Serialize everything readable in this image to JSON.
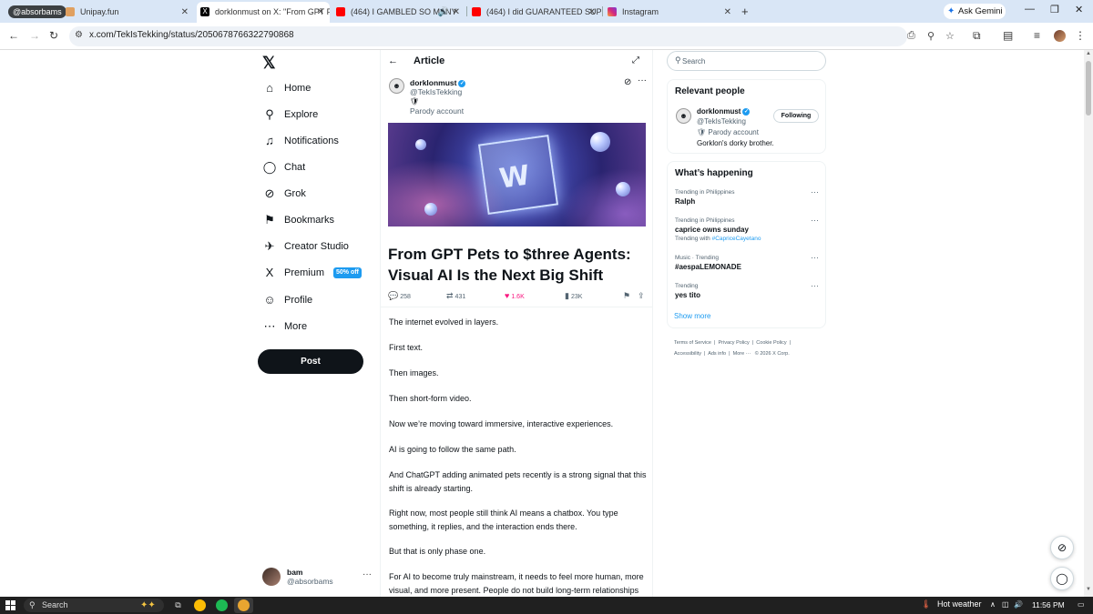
{
  "browser": {
    "profile_chip": "@absorbams",
    "tabs": [
      {
        "title": "Unipay.fun",
        "icon": "unipay-favicon"
      },
      {
        "title": "dorklonmust on X: \"From GPT P",
        "icon": "x-favicon"
      },
      {
        "title": "(464) I GAMBLED SO MANY",
        "icon": "youtube-favicon"
      },
      {
        "title": "(464) I did GUARANTEED SUPER",
        "icon": "youtube-favicon"
      },
      {
        "title": "Instagram",
        "icon": "instagram-favicon"
      }
    ],
    "gemini_label": "Ask Gemini",
    "url": "x.com/TekIsTekking/status/2050678766322790868"
  },
  "sidenav": {
    "items": [
      {
        "label": "Home",
        "icon": "⌂"
      },
      {
        "label": "Explore",
        "icon": "⚲"
      },
      {
        "label": "Notifications",
        "icon": "♫"
      },
      {
        "label": "Chat",
        "icon": "◯"
      },
      {
        "label": "Grok",
        "icon": "⊘"
      },
      {
        "label": "Bookmarks",
        "icon": "⚑"
      },
      {
        "label": "Creator Studio",
        "icon": "✈"
      },
      {
        "label": "Premium",
        "icon": "X"
      },
      {
        "label": "Profile",
        "icon": "☺"
      },
      {
        "label": "More",
        "icon": "⋯"
      }
    ],
    "premium_badge": "50% off",
    "post_label": "Post",
    "me": {
      "name": "bam",
      "handle": "@absorbams"
    }
  },
  "article": {
    "header_title": "Article",
    "author": {
      "name": "dorklonmust",
      "handle": "@TekIsTekking",
      "emoji": "🛡",
      "parody": "Parody account"
    },
    "headline": "From GPT Pets to $three Agents: Visual AI Is the Next Big Shift",
    "hero_text": "W",
    "stats": {
      "replies": "258",
      "reposts": "431",
      "likes": "1.6K",
      "views": "23K"
    },
    "paragraphs": [
      "The internet evolved in layers.",
      "First text.",
      "Then images.",
      "Then short-form video.",
      "Now we’re moving toward immersive, interactive experiences.",
      "AI is going to follow the same path.",
      "And ChatGPT adding animated pets recently is a strong signal that this shift is already starting.",
      "Right now, most people still think AI means a chatbox. You type something, it replies, and the interaction ends there.",
      "But that is only phase one.",
      "For AI to become truly mainstream, it needs to feel more human, more visual, and more present. People do not build long-term relationships"
    ]
  },
  "right": {
    "search_placeholder": "Search",
    "relevant_title": "Relevant people",
    "relevant": {
      "name": "dorklonmust",
      "handle": "@TekIsTekking",
      "parody": "🛡 Parody account",
      "bio": "Gorklon's dorky brother.",
      "button": "Following"
    },
    "happening_title": "What’s happening",
    "trends": [
      {
        "context": "Trending in Philippines",
        "title": "Ralph",
        "with": "",
        "tag": ""
      },
      {
        "context": "Trending in Philippines",
        "title": "caprice owns sunday",
        "with": "Trending with",
        "tag": "#CapriceCayetano"
      },
      {
        "context": "Music · Trending",
        "title": "#aespaLEMONADE",
        "with": "",
        "tag": ""
      },
      {
        "context": "Trending",
        "title": "yes tito",
        "with": "",
        "tag": ""
      }
    ],
    "show_more": "Show more",
    "footer": [
      "Terms of Service",
      "Privacy Policy",
      "Cookie Policy",
      "Accessibility",
      "Ads info",
      "More ···",
      "© 2026 X Corp."
    ]
  },
  "taskbar": {
    "search": "Search",
    "weather": "Hot weather",
    "time": "11:56 PM"
  },
  "colors": {
    "accent": "#1d9bf0",
    "like": "#f91880",
    "text": "#0f1419",
    "muted": "#536471"
  }
}
